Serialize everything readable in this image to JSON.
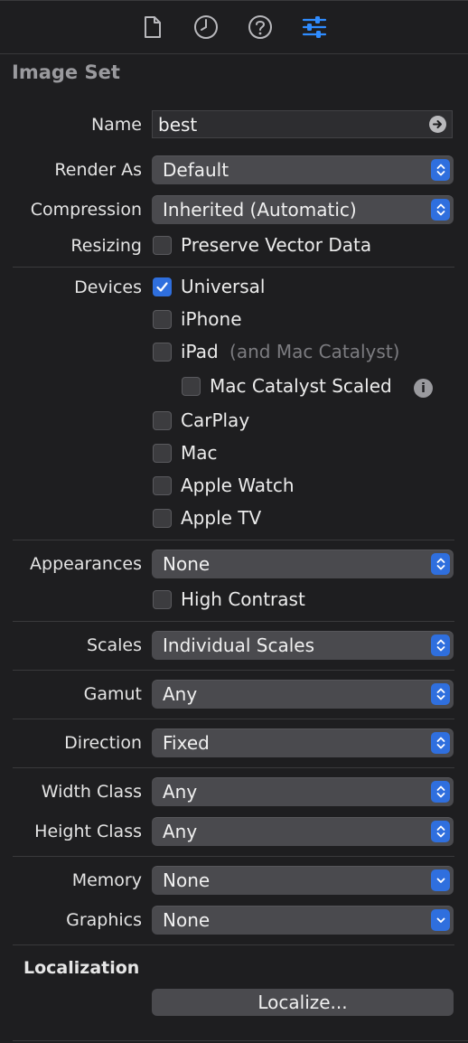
{
  "tabs": [
    {
      "name": "file-inspector",
      "icon": "file-icon"
    },
    {
      "name": "history-inspector",
      "icon": "clock-icon"
    },
    {
      "name": "quick-help",
      "icon": "question-icon"
    },
    {
      "name": "attributes-inspector",
      "icon": "sliders-icon",
      "selected": true
    }
  ],
  "section_title": "Image Set",
  "name": {
    "label": "Name",
    "value": "best"
  },
  "render_as": {
    "label": "Render As",
    "value": "Default"
  },
  "compression": {
    "label": "Compression",
    "value": "Inherited (Automatic)"
  },
  "resizing": {
    "label": "Resizing",
    "option": "Preserve Vector Data",
    "checked": false
  },
  "devices": {
    "label": "Devices",
    "universal": {
      "label": "Universal",
      "checked": true
    },
    "iphone": {
      "label": "iPhone",
      "checked": false
    },
    "ipad": {
      "label": "iPad",
      "note": "(and Mac Catalyst)",
      "checked": false
    },
    "mac_catalyst_scaled": {
      "label": "Mac Catalyst Scaled",
      "checked": false
    },
    "carplay": {
      "label": "CarPlay",
      "checked": false
    },
    "mac": {
      "label": "Mac",
      "checked": false
    },
    "apple_watch": {
      "label": "Apple Watch",
      "checked": false
    },
    "apple_tv": {
      "label": "Apple TV",
      "checked": false
    }
  },
  "appearances": {
    "label": "Appearances",
    "value": "None",
    "high_contrast": "High Contrast",
    "high_contrast_checked": false
  },
  "scales": {
    "label": "Scales",
    "value": "Individual Scales"
  },
  "gamut": {
    "label": "Gamut",
    "value": "Any"
  },
  "direction": {
    "label": "Direction",
    "value": "Fixed"
  },
  "width_class": {
    "label": "Width Class",
    "value": "Any"
  },
  "height_class": {
    "label": "Height Class",
    "value": "Any"
  },
  "memory": {
    "label": "Memory",
    "value": "None"
  },
  "graphics": {
    "label": "Graphics",
    "value": "None"
  },
  "localization": {
    "title": "Localization",
    "button": "Localize..."
  },
  "colors": {
    "accent": "#2f6fde",
    "background": "#1e1e20",
    "control": "#4a4a4e"
  }
}
